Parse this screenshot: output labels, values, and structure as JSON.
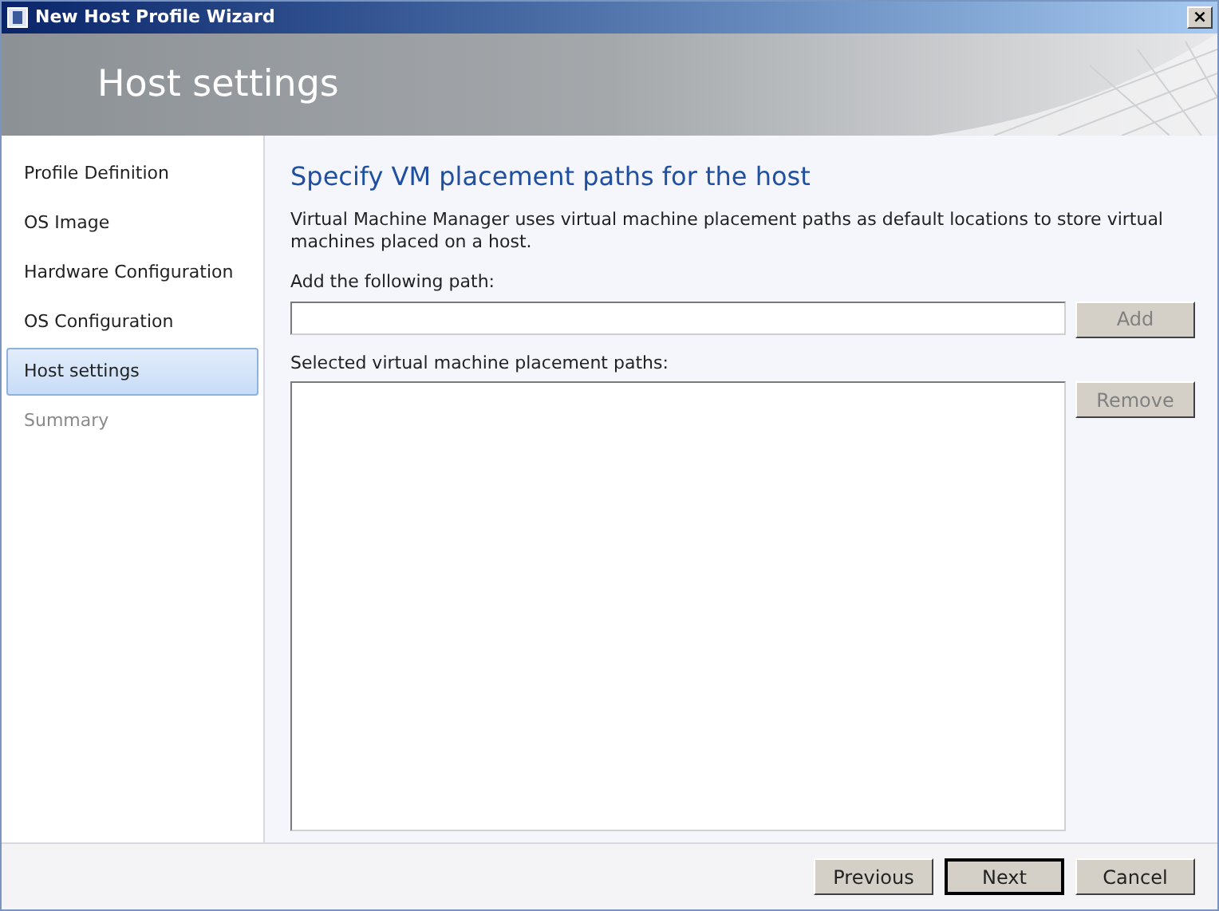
{
  "window": {
    "title": "New Host Profile Wizard",
    "close": "×"
  },
  "header": {
    "title": "Host settings"
  },
  "sidebar": {
    "items": [
      {
        "label": "Profile Definition",
        "selected": false,
        "disabled": false
      },
      {
        "label": "OS Image",
        "selected": false,
        "disabled": false
      },
      {
        "label": "Hardware Configuration",
        "selected": false,
        "disabled": false
      },
      {
        "label": "OS Configuration",
        "selected": false,
        "disabled": false
      },
      {
        "label": "Host settings",
        "selected": true,
        "disabled": false
      },
      {
        "label": "Summary",
        "selected": false,
        "disabled": true
      }
    ]
  },
  "content": {
    "heading": "Specify VM placement paths for the host",
    "description": "Virtual Machine Manager uses virtual machine placement paths as default locations to store virtual machines placed on a host.",
    "path_label": "Add the following path:",
    "add_button": {
      "label": "Add",
      "disabled": true
    },
    "list_label": "Selected virtual machine placement paths:",
    "remove_button": {
      "label": "Remove",
      "disabled": true
    }
  },
  "footer": {
    "buttons": [
      {
        "label": "Previous",
        "default": false
      },
      {
        "label": "Next",
        "default": true
      },
      {
        "label": "Cancel",
        "default": false
      }
    ]
  }
}
